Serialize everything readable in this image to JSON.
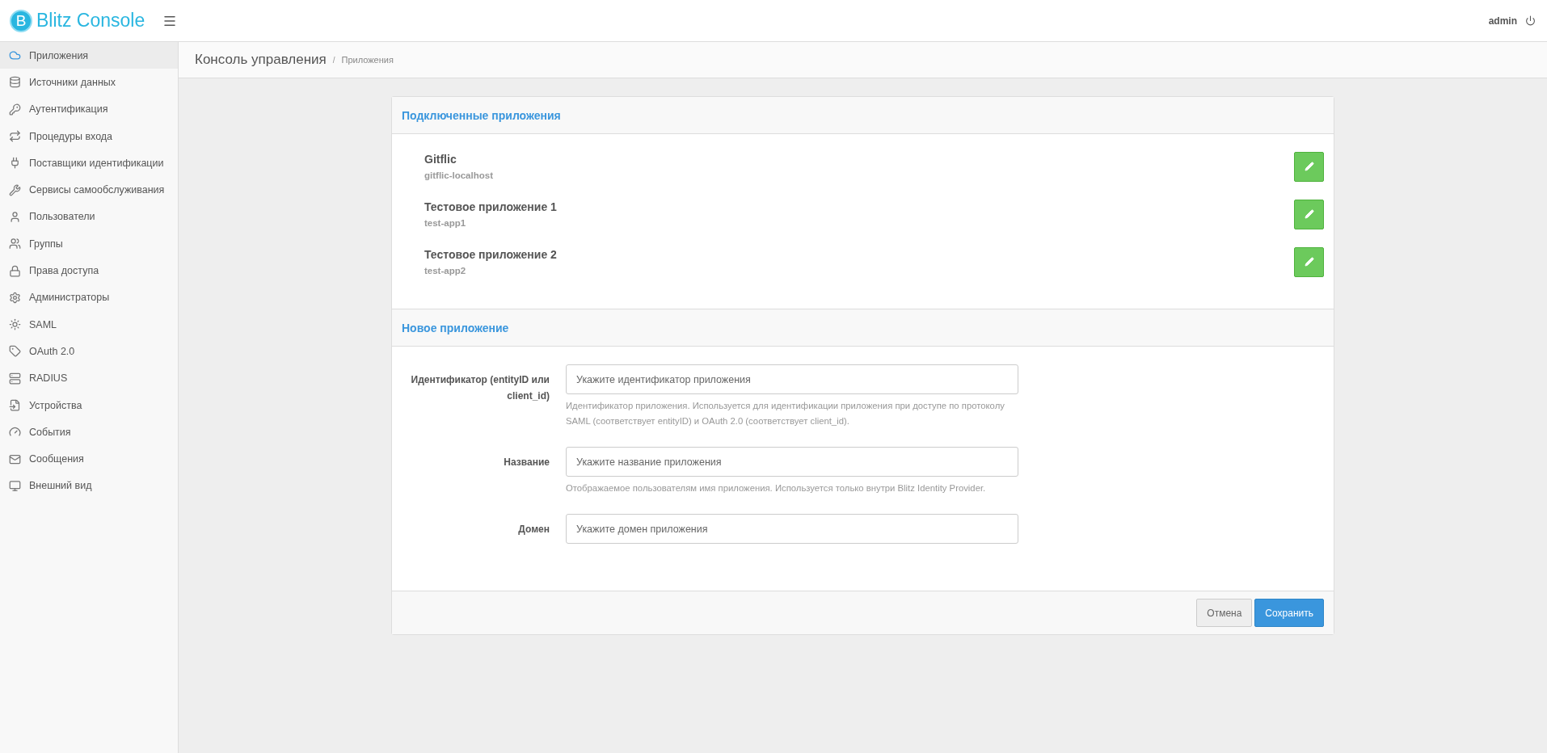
{
  "header": {
    "logo_letter": "B",
    "brand": "Blitz Console",
    "user": "admin"
  },
  "sidebar": {
    "items": [
      {
        "label": "Приложения",
        "selected": true
      },
      {
        "label": "Источники данных",
        "selected": false
      },
      {
        "label": "Аутентификация",
        "selected": false
      },
      {
        "label": "Процедуры входа",
        "selected": false
      },
      {
        "label": "Поставщики идентификации",
        "selected": false
      },
      {
        "label": "Сервисы самообслуживания",
        "selected": false
      },
      {
        "label": "Пользователи",
        "selected": false
      },
      {
        "label": "Группы",
        "selected": false
      },
      {
        "label": "Права доступа",
        "selected": false
      },
      {
        "label": "Администраторы",
        "selected": false
      },
      {
        "label": "SAML",
        "selected": false
      },
      {
        "label": "OAuth 2.0",
        "selected": false
      },
      {
        "label": "RADIUS",
        "selected": false
      },
      {
        "label": "Устройства",
        "selected": false
      },
      {
        "label": "События",
        "selected": false
      },
      {
        "label": "Сообщения",
        "selected": false
      },
      {
        "label": "Внешний вид",
        "selected": false
      }
    ]
  },
  "breadcrumb": {
    "title": "Консоль управления",
    "separator": "/",
    "current": "Приложения"
  },
  "connected_apps": {
    "title": "Подключенные приложения",
    "apps": [
      {
        "name": "Gitflic",
        "id": "gitflic-localhost"
      },
      {
        "name": "Тестовое приложение 1",
        "id": "test-app1"
      },
      {
        "name": "Тестовое приложение 2",
        "id": "test-app2"
      }
    ]
  },
  "new_app": {
    "title": "Новое приложение",
    "fields": [
      {
        "label": "Идентификатор (entityID или client_id)",
        "placeholder": "Укажите идентификатор приложения",
        "help": "Идентификатор приложения. Используется для идентификации приложения при доступе по протоколу SAML (соответствует entityID) и OAuth 2.0 (соответствует client_id)."
      },
      {
        "label": "Название",
        "placeholder": "Укажите название приложения",
        "help": "Отображаемое пользователям имя приложения. Используется только внутри Blitz Identity Provider."
      },
      {
        "label": "Домен",
        "placeholder": "Укажите домен приложения"
      }
    ],
    "buttons": [
      {
        "label": "Отмена",
        "kind": "default"
      },
      {
        "label": "Сохранить",
        "kind": "primary"
      }
    ]
  }
}
